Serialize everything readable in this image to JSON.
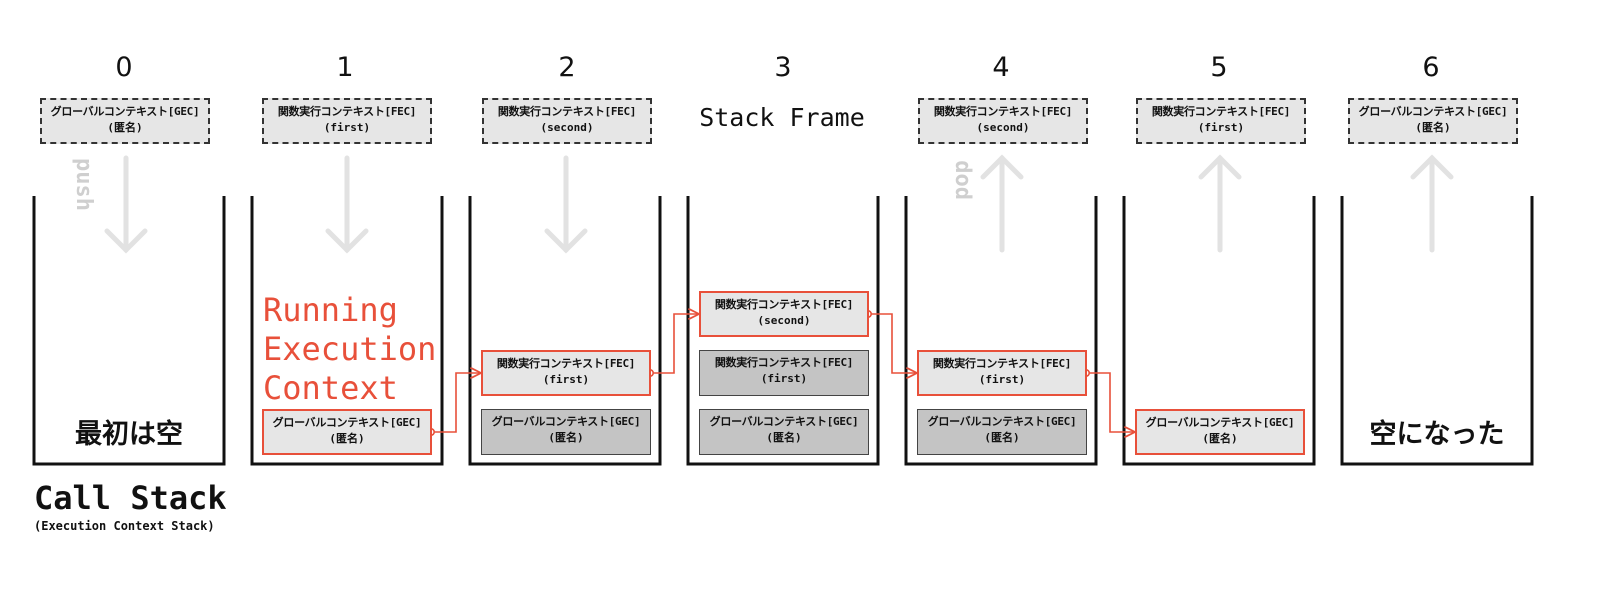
{
  "steps": [
    "0",
    "1",
    "2",
    "3",
    "4",
    "5",
    "6"
  ],
  "top_contexts": {
    "s0": {
      "line1": "グローバルコンテキスト[GEC]",
      "line2": "(匿名)"
    },
    "s1": {
      "line1": "関数実行コンテキスト[FEC]",
      "line2": "(first)"
    },
    "s2": {
      "line1": "関数実行コンテキスト[FEC]",
      "line2": "(second)"
    },
    "s4": {
      "line1": "関数実行コンテキスト[FEC]",
      "line2": "(second)"
    },
    "s5": {
      "line1": "関数実行コンテキスト[FEC]",
      "line2": "(first)"
    },
    "s6": {
      "line1": "グローバルコンテキスト[GEC]",
      "line2": "(匿名)"
    }
  },
  "stack_frame_label": "Stack Frame",
  "push_label": "push",
  "pop_label": "pop",
  "running_label": "Running\nExecution\nContext",
  "empty_start": "最初は空",
  "empty_end": "空になった",
  "frames": {
    "s1_gec": {
      "line1": "グローバルコンテキスト[GEC]",
      "line2": "(匿名)"
    },
    "s2_fec_first": {
      "line1": "関数実行コンテキスト[FEC]",
      "line2": "(first)"
    },
    "s2_gec": {
      "line1": "グローバルコンテキスト[GEC]",
      "line2": "(匿名)"
    },
    "s3_fec_second": {
      "line1": "関数実行コンテキスト[FEC]",
      "line2": "(second)"
    },
    "s3_fec_first": {
      "line1": "関数実行コンテキスト[FEC]",
      "line2": "(first)"
    },
    "s3_gec": {
      "line1": "グローバルコンテキスト[GEC]",
      "line2": "(匿名)"
    },
    "s4_fec_first": {
      "line1": "関数実行コンテキスト[FEC]",
      "line2": "(first)"
    },
    "s4_gec": {
      "line1": "グローバルコンテキスト[GEC]",
      "line2": "(匿名)"
    },
    "s5_gec": {
      "line1": "グローバルコンテキスト[GEC]",
      "line2": "(匿名)"
    }
  },
  "call_stack_title": "Call Stack",
  "call_stack_subtitle": "(Execution Context Stack)",
  "colors": {
    "accent": "#e8503a",
    "frame_active": "#e6e6e6",
    "frame_inactive": "#c4c4c4",
    "arrow": "#e2e2e2"
  }
}
